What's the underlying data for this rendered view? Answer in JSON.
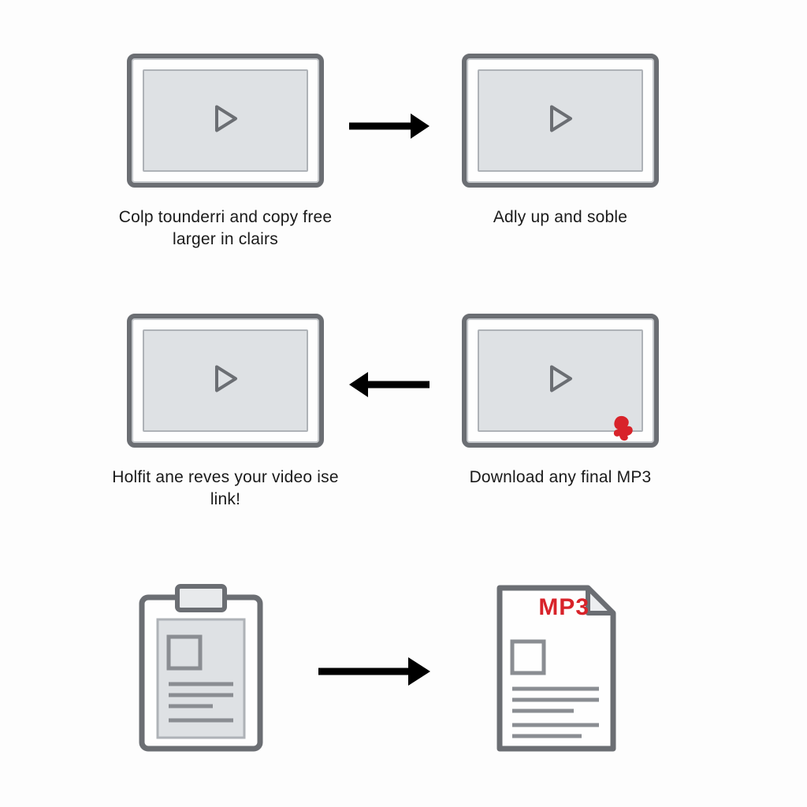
{
  "steps": {
    "s1": {
      "caption": "Colp tounderri and copy free larger in clairs"
    },
    "s2": {
      "caption": "Adly up and soble"
    },
    "s3": {
      "caption": "Holfit ane reves your video ise link!"
    },
    "s4": {
      "caption": "Download any final MP3"
    }
  },
  "file_label": "MP3"
}
